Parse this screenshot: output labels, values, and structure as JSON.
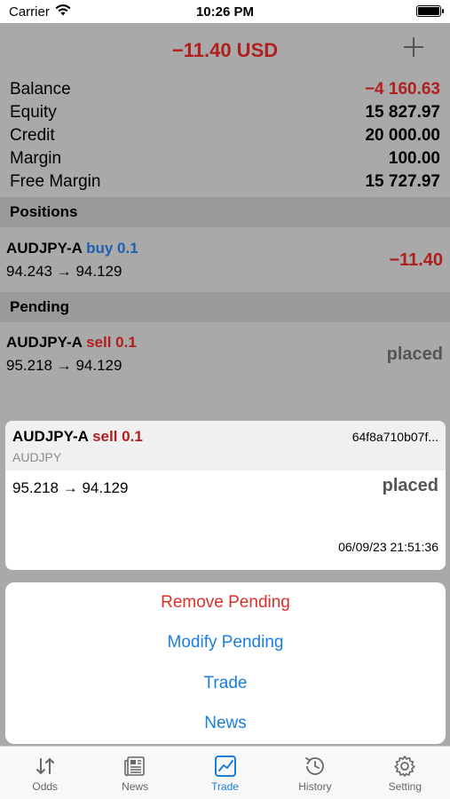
{
  "status_bar": {
    "carrier": "Carrier",
    "time": "10:26 PM"
  },
  "header": {
    "total": "−11.40 USD",
    "add_icon": "plus-icon"
  },
  "account": {
    "rows": [
      {
        "label": "Balance",
        "value": "−4 160.63",
        "negative": true
      },
      {
        "label": "Equity",
        "value": "15 827.97"
      },
      {
        "label": "Credit",
        "value": "20 000.00"
      },
      {
        "label": "Margin",
        "value": "100.00"
      },
      {
        "label": "Free Margin",
        "value": "15 727.97"
      }
    ]
  },
  "positions": {
    "title": "Positions",
    "item": {
      "symbol": "AUDJPY-A",
      "side": "buy 0.1",
      "prices": "94.243 → 94.129",
      "profit": "−11.40"
    }
  },
  "pending": {
    "title": "Pending",
    "item": {
      "symbol": "AUDJPY-A",
      "side": "sell 0.1",
      "prices": "95.218 → 94.129",
      "status": "placed"
    }
  },
  "detail_card": {
    "symbol": "AUDJPY-A",
    "side": "sell 0.1",
    "order_id": "64f8a710b07f...",
    "sub_symbol": "AUDJPY",
    "prices": "95.218 → 94.129",
    "status": "placed",
    "timestamp": "06/09/23 21:51:36"
  },
  "actions": {
    "remove": "Remove Pending",
    "modify": "Modify Pending",
    "trade": "Trade",
    "news": "News"
  },
  "tabs": {
    "odds": "Odds",
    "news": "News",
    "trade": "Trade",
    "history": "History",
    "setting": "Setting",
    "active": "Trade"
  },
  "colors": {
    "negative": "#b01e1e",
    "buy": "#1f5fb3",
    "accent": "#1a7ee0",
    "destructive": "#d9302a"
  }
}
